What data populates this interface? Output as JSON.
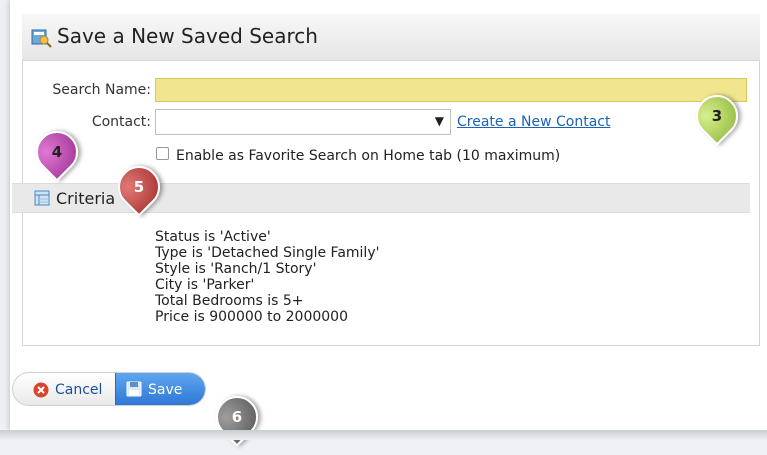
{
  "dialog": {
    "title": "Save a New Saved Search"
  },
  "form": {
    "search_name_label": "Search Name:",
    "search_name_value": "",
    "contact_label": "Contact:",
    "contact_selected": "",
    "create_contact_link": "Create a New Contact",
    "favorite_label": "Enable as Favorite Search on Home tab (10 maximum)",
    "favorite_checked": false
  },
  "criteria": {
    "header": "Criteria",
    "lines": [
      "Status is 'Active'",
      "Type is 'Detached Single Family'",
      "Style is 'Ranch/1 Story'",
      "City is 'Parker'",
      "Total Bedrooms is 5+",
      "Price is 900000 to 2000000"
    ]
  },
  "buttons": {
    "cancel": "Cancel",
    "save": "Save"
  },
  "callouts": [
    "3",
    "4",
    "5",
    "6"
  ],
  "colors": {
    "search_name_bg": "#f1e68f",
    "link": "#1a63b5",
    "save_button": "#2f78d6"
  }
}
